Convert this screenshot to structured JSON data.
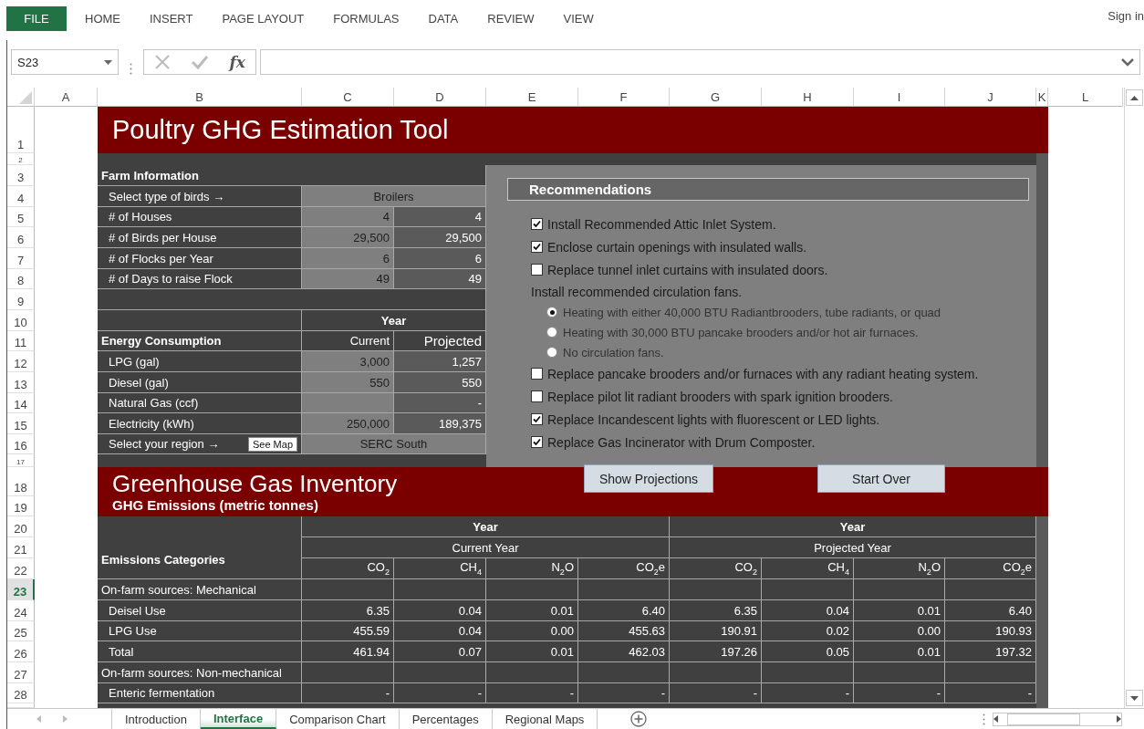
{
  "ribbon": {
    "file_tab": "FILE",
    "tabs": [
      "HOME",
      "INSERT",
      "PAGE LAYOUT",
      "FORMULAS",
      "DATA",
      "REVIEW",
      "VIEW"
    ],
    "sign_in": "Sign in"
  },
  "formula_bar": {
    "name_box": "S23",
    "function_button": "fx"
  },
  "columns": [
    "A",
    "B",
    "C",
    "D",
    "E",
    "F",
    "G",
    "H",
    "I",
    "J",
    "K",
    "L"
  ],
  "row_headers": [
    {
      "label": "1",
      "selected": false
    },
    {
      "label": "2",
      "selected": false
    },
    {
      "label": "3",
      "selected": false
    },
    {
      "label": "4",
      "selected": false
    },
    {
      "label": "5",
      "selected": false
    },
    {
      "label": "6",
      "selected": false
    },
    {
      "label": "7",
      "selected": false
    },
    {
      "label": "8",
      "selected": false
    },
    {
      "label": "9",
      "selected": false
    },
    {
      "label": "10",
      "selected": false
    },
    {
      "label": "11",
      "selected": false
    },
    {
      "label": "12",
      "selected": false
    },
    {
      "label": "13",
      "selected": false
    },
    {
      "label": "14",
      "selected": false
    },
    {
      "label": "15",
      "selected": false
    },
    {
      "label": "16",
      "selected": false
    },
    {
      "label": "17",
      "selected": false
    },
    {
      "label": "18",
      "selected": false
    },
    {
      "label": "19",
      "selected": false
    },
    {
      "label": "20",
      "selected": false
    },
    {
      "label": "21",
      "selected": false
    },
    {
      "label": "22",
      "selected": false
    },
    {
      "label": "23",
      "selected": true
    },
    {
      "label": "24",
      "selected": false
    },
    {
      "label": "25",
      "selected": false
    },
    {
      "label": "26",
      "selected": false
    },
    {
      "label": "27",
      "selected": false
    },
    {
      "label": "28",
      "selected": false
    }
  ],
  "title": "Poultry GHG Estimation Tool",
  "farm_information": {
    "heading": "Farm Information",
    "bird_type": {
      "label": "Select type of birds →",
      "value": "Broilers"
    },
    "rows": [
      {
        "label": "# of Houses",
        "current": "4",
        "projected": "4"
      },
      {
        "label": "# of Birds per House",
        "current": "29,500",
        "projected": "29,500"
      },
      {
        "label": "# of Flocks per Year",
        "current": "6",
        "projected": "6"
      },
      {
        "label": "# of Days to raise Flock",
        "current": "49",
        "projected": "49"
      }
    ]
  },
  "energy": {
    "year_heading": "Year",
    "heading": "Energy Consumption",
    "current_heading": "Current",
    "projected_heading": "Projected",
    "rows": [
      {
        "label": "LPG (gal)",
        "current": "3,000",
        "projected": "1,257"
      },
      {
        "label": "Diesel (gal)",
        "current": "550",
        "projected": "550"
      },
      {
        "label": "Natural Gas (ccf)",
        "projected": "-"
      },
      {
        "label": "Electricity (kWh)",
        "current": "250,000",
        "projected": "189,375"
      }
    ],
    "region": {
      "label": "Select your region →",
      "button": "See Map",
      "value": "SERC South"
    }
  },
  "recommendations": {
    "heading": "Recommendations",
    "items": [
      {
        "kind": "checkbox",
        "label": "Install Recommended Attic Inlet System.",
        "checked": true
      },
      {
        "kind": "checkbox",
        "label": "Enclose curtain openings with insulated walls.",
        "checked": true
      },
      {
        "kind": "checkbox",
        "label": "Replace tunnel inlet curtains with insulated doors.",
        "checked": false
      },
      {
        "kind": "text",
        "label": "Install recommended circulation fans."
      },
      {
        "kind": "radio",
        "label": "Heating with either 40,000 BTU Radiantbrooders, tube radiants, or quad",
        "selected": true
      },
      {
        "kind": "radio",
        "label": "Heating with 30,000 BTU pancake brooders and/or hot air furnaces.",
        "selected": false
      },
      {
        "kind": "radio",
        "label": "No circulation fans.",
        "selected": false
      },
      {
        "kind": "checkbox",
        "label": "Replace pancake brooders and/or furnaces with any radiant heating system.",
        "checked": false
      },
      {
        "kind": "checkbox",
        "label": "Replace pilot lit radiant brooders with spark ignition brooders.",
        "checked": false
      },
      {
        "kind": "checkbox",
        "label": "Replace Incandescent lights with fluorescent or LED lights.",
        "checked": true
      },
      {
        "kind": "checkbox",
        "label": "Replace Gas Incinerator with Drum Composter.",
        "checked": true
      }
    ]
  },
  "buttons": [
    "Show Projections",
    "Start Over"
  ],
  "inventory": {
    "title": "Greenhouse Gas Inventory",
    "subtitle": "GHG Emissions (metric tonnes)",
    "category_heading": "Emissions Categories",
    "groups": [
      {
        "year": "Year",
        "period": "Current Year",
        "gases": [
          "CO$_{2}$",
          "CH$_{4}$",
          "N$_{2}$O",
          "CO$_{2}$e"
        ]
      },
      {
        "year": "Year",
        "period": "Projected Year",
        "gases": [
          "CO$_{2}$",
          "CH$_{4}$",
          "N$_{2}$O",
          "CO$_{2}$e"
        ]
      }
    ],
    "rows": [
      {
        "kind": "section",
        "label": "On-farm sources: Mechanical"
      },
      {
        "kind": "item",
        "label": "Deisel Use",
        "values": [
          "6.35",
          "0.04",
          "0.01",
          "6.40",
          "6.35",
          "0.04",
          "0.01",
          "6.40"
        ]
      },
      {
        "kind": "item",
        "label": "LPG Use",
        "values": [
          "455.59",
          "0.04",
          "0.00",
          "455.63",
          "190.91",
          "0.02",
          "0.00",
          "190.93"
        ]
      },
      {
        "kind": "item",
        "label": "Total",
        "values": [
          "461.94",
          "0.07",
          "0.01",
          "462.03",
          "197.26",
          "0.05",
          "0.01",
          "197.32"
        ]
      },
      {
        "kind": "section",
        "label": "On-farm sources: Non-mechanical"
      },
      {
        "kind": "item",
        "label": "Enteric fermentation",
        "values": [
          "-",
          "-",
          "-",
          "-",
          "-",
          "-",
          "-",
          "-"
        ]
      }
    ]
  },
  "sheet_tabs": [
    {
      "label": "Introduction",
      "selected": false
    },
    {
      "label": "Interface",
      "selected": true
    },
    {
      "label": "Comparison Chart",
      "selected": false
    },
    {
      "label": "Percentages",
      "selected": false
    },
    {
      "label": "Regional Maps",
      "selected": false
    }
  ]
}
